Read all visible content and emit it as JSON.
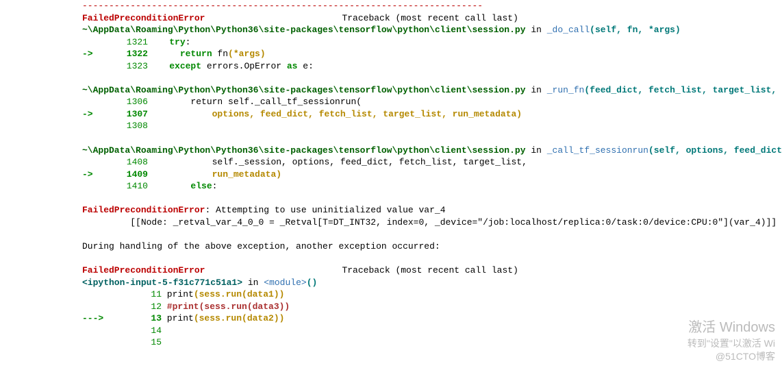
{
  "hr": "---------------------------------------------------------------------------",
  "err_name": "FailedPreconditionError",
  "tb_recent": "Traceback (most recent call last)",
  "frames": [
    {
      "path": "~\\AppData\\Roaming\\Python\\Python36\\site-packages\\tensorflow\\python\\client\\session.py",
      "in": " in ",
      "func": "_do_call",
      "args": "(self, fn, *args)",
      "lines": [
        {
          "no": "1321",
          "arrow": "",
          "pre": "",
          "kw": "try",
          "post": ":"
        },
        {
          "no": "1322",
          "arrow": "-> ",
          "pre": "",
          "kw": "return",
          "post_code": " fn",
          "postargs": "(*args)"
        },
        {
          "no": "1323",
          "arrow": "",
          "pre": "",
          "kw": "except",
          "post_plain_a": " errors.OpError ",
          "kw2": "as",
          "post_plain_b": " e:"
        }
      ]
    },
    {
      "path": "~\\AppData\\Roaming\\Python\\Python36\\site-packages\\tensorflow\\python\\client\\session.py",
      "in": " in ",
      "func": "_run_fn",
      "args": "(feed_dict, fetch_list, target_list, options, run_metadata)",
      "lines": [
        {
          "no": "1306",
          "arrow": "",
          "plain": "return self._call_tf_sessionrun("
        },
        {
          "no": "1307",
          "arrow": "-> ",
          "yellowargs": "options, feed_dict, fetch_list, target_list, run_metadata)"
        },
        {
          "no": "1308",
          "arrow": "",
          "plain": ""
        }
      ]
    },
    {
      "path": "~\\AppData\\Roaming\\Python\\Python36\\site-packages\\tensorflow\\python\\client\\session.py",
      "in": " in ",
      "func": "_call_tf_sessionrun",
      "args": "(self, options, feed_dict, fetch_list, target_list, run_metadata)",
      "lines": [
        {
          "no": "1408",
          "arrow": "",
          "plain": "self._session, options, feed_dict, fetch_list, target_list,"
        },
        {
          "no": "1409",
          "arrow": "-> ",
          "yellowargs": "run_metadata)"
        },
        {
          "no": "1410",
          "arrow": "",
          "kw": "else",
          "post": ":"
        }
      ]
    }
  ],
  "err_msg": ": Attempting to use uninitialized value var_4",
  "node_line": "[[Node: _retval_var_4_0_0 = _Retval[T=DT_INT32, index=0, _device=\"/job:localhost/replica:0/task:0/device:CPU:0\"](var_4)]]",
  "during": "During handling of the above exception, another exception occurred:",
  "ip_prompt": "<ipython-input-5-f31c771c51a1>",
  "ip_in": " in ",
  "ip_module": "<module>",
  "ip_paren": "()",
  "ip_lines": [
    {
      "no": "11",
      "arrow": "",
      "text_a": " print",
      "text_b": "(sess.run(data1",
      "text_c": "))",
      "comment": false
    },
    {
      "no": "12",
      "arrow": "",
      "comment": true,
      "commenttext": " #print(sess.run(data3))"
    },
    {
      "no": "13",
      "arrow": "---> ",
      "text_a": " print",
      "text_b": "(sess.run(data2",
      "text_c": "))",
      "comment": false
    },
    {
      "no": "14",
      "arrow": "",
      "text_a": "",
      "text_b": "",
      "text_c": "",
      "comment": false
    },
    {
      "no": "15",
      "arrow": "",
      "text_a": "",
      "text_b": "",
      "text_c": "",
      "comment": false
    }
  ],
  "watermark": {
    "big": "激活 Windows",
    "small": "转到\"设置\"以激活 Wi",
    "credit": "@51CTO博客"
  }
}
